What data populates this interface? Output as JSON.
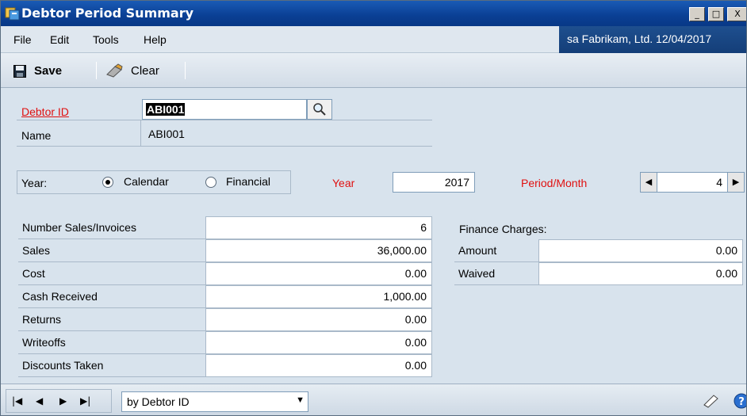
{
  "window": {
    "title": "Debtor Period Summary",
    "minimize": "_",
    "maximize": "□",
    "close": "X"
  },
  "menu": {
    "items": [
      "File",
      "Edit",
      "Tools",
      "Help"
    ],
    "company": "sa  Fabrikam, Ltd.  12/04/2017"
  },
  "toolbar": {
    "save_label": "Save",
    "clear_label": "Clear"
  },
  "form": {
    "debtor_id_label": "Debtor ID",
    "debtor_id_value": "ABI001",
    "name_label": "Name",
    "name_value": "ABI001",
    "year_type_label": "Year:",
    "calendar_label": "Calendar",
    "financial_label": "Financial",
    "year_label": "Year",
    "year_value": "2017",
    "period_label": "Period/Month",
    "period_value": "4",
    "year_type_selected": "Calendar"
  },
  "summary": {
    "rows": [
      {
        "label": "Number Sales/Invoices",
        "value": "6"
      },
      {
        "label": "Sales",
        "value": "36,000.00"
      },
      {
        "label": "Cost",
        "value": "0.00"
      },
      {
        "label": "Cash Received",
        "value": "1,000.00"
      },
      {
        "label": "Returns",
        "value": "0.00"
      },
      {
        "label": "Writeoffs",
        "value": "0.00"
      },
      {
        "label": "Discounts Taken",
        "value": "0.00"
      }
    ]
  },
  "finance": {
    "heading": "Finance Charges:",
    "rows": [
      {
        "label": "Amount",
        "value": "0.00"
      },
      {
        "label": "Waived",
        "value": "0.00"
      }
    ]
  },
  "bottom": {
    "sort_value": "by Debtor ID"
  },
  "colors": {
    "title_bar": "#0a3f94",
    "required_label": "#e01010",
    "form_background": "#d8e3ed"
  }
}
